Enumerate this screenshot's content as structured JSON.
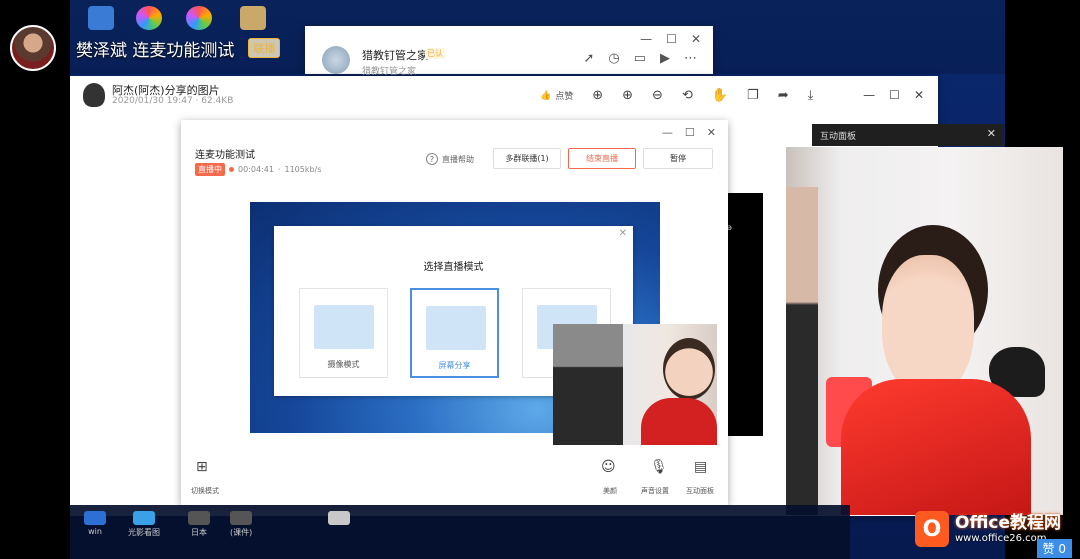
{
  "streamer": {
    "name": "樊泽斌 连麦功能测试",
    "tag": "联播"
  },
  "chat_window": {
    "name": "猎教钉管之家",
    "subtitle": "猎教钉管之家",
    "chip": "已认",
    "tools": [
      "share-icon",
      "clock-icon",
      "folder-icon",
      "video-icon",
      "more-icon"
    ],
    "controls": [
      "—",
      "☐",
      "✕"
    ]
  },
  "viewer": {
    "title": "阿杰(阿杰)分享的图片",
    "meta": "2020/01/30 19:47 · 62.4KB",
    "like_label": "点赞",
    "tools": [
      "zoom-in-icon",
      "zoom-in-alt-icon",
      "zoom-out-icon",
      "rotate-icon",
      "hand-icon",
      "copy-icon",
      "share-icon",
      "download-icon"
    ],
    "controls": [
      "—",
      "☐",
      "✕"
    ]
  },
  "black_side_text": "ǝ",
  "live_window": {
    "title": "连麦功能测试",
    "status_badge": "直播中",
    "duration": "00:04:41",
    "bitrate": "1105kb/s",
    "help_label": "直播帮助",
    "buttons": {
      "multi_group": "多群联播(1)",
      "end_live": "结束直播",
      "pause": "暂停"
    },
    "controls": [
      "—",
      "☐",
      "✕"
    ],
    "mode_dialog": {
      "title": "选择直播模式",
      "options": [
        {
          "label": "摄像模式"
        },
        {
          "label": "屏幕分享"
        },
        {
          "label": ""
        }
      ]
    },
    "bottom": {
      "switch_mode": "切换模式",
      "beauty": "美颜",
      "audio_settings": "声音设置",
      "interactive": "互动面板"
    }
  },
  "interactive_panel": {
    "title": "互动面板",
    "close": "✕"
  },
  "taskbar": {
    "items": [
      {
        "label": "win"
      },
      {
        "label": "光影看图"
      },
      {
        "label": "日本"
      },
      {
        "label": "(课件)"
      }
    ]
  },
  "watermark": {
    "brand": "Office教程网",
    "url": "www.office26.com"
  },
  "likes": "赞 0"
}
